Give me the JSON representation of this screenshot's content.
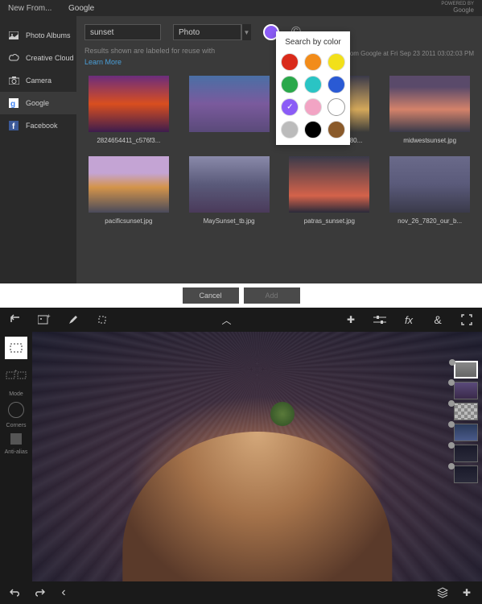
{
  "header": {
    "title": "New From...",
    "source": "Google",
    "powered_by": "POWERED BY",
    "logo": "Google"
  },
  "sidebar": {
    "items": [
      {
        "id": "photo-albums",
        "label": "Photo Albums"
      },
      {
        "id": "creative-cloud",
        "label": "Creative Cloud"
      },
      {
        "id": "camera",
        "label": "Camera"
      },
      {
        "id": "google",
        "label": "Google"
      },
      {
        "id": "facebook",
        "label": "Facebook"
      }
    ]
  },
  "search": {
    "query": "sunset",
    "type": "Photo",
    "color_hex": "#8b5cf6"
  },
  "info": {
    "text": "Results shown are labeled for reuse with",
    "link": "Learn More"
  },
  "clip_info": "Clipped from Google at Fri Sep 23 2011 03:02:03 PM",
  "color_popup": {
    "title": "Search by color",
    "colors": [
      "#d92a1a",
      "#f28c1a",
      "#f2e01a",
      "#2aa84a",
      "#2ac4c4",
      "#2a5ad4",
      "#8b5cf6",
      "#f2a4c4",
      "#ffffff",
      "#bbbbbb",
      "#000000",
      "#8a5a2a"
    ],
    "selected_index": 6
  },
  "grid": [
    {
      "label": "2824654411_c576f3..."
    },
    {
      "label": ""
    },
    {
      "label": "MaySunset_1280x80..."
    },
    {
      "label": "midwestsunset.jpg"
    },
    {
      "label": "pacificsunset.jpg"
    },
    {
      "label": "MaySunset_tb.jpg"
    },
    {
      "label": "patras_sunset.jpg"
    },
    {
      "label": "nov_26_7820_our_b..."
    }
  ],
  "mid": {
    "cancel": "Cancel",
    "add": "Add"
  },
  "editor": {
    "left_labels": {
      "mode": "Mode",
      "corners": "Corners",
      "anti_alias": "Anti-alias"
    }
  }
}
